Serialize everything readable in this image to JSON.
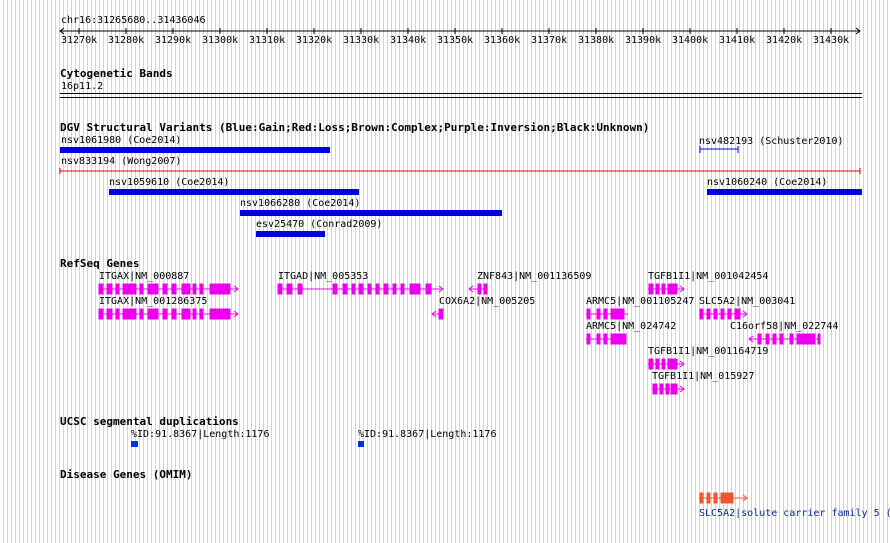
{
  "ruler": {
    "position": "chr16:31265680..31436046",
    "ticks": [
      "31270k",
      "31280k",
      "31290k",
      "31300k",
      "31310k",
      "31320k",
      "31330k",
      "31340k",
      "31350k",
      "31360k",
      "31370k",
      "31380k",
      "31390k",
      "31400k",
      "31410k",
      "31420k",
      "31430k"
    ]
  },
  "cytobands": {
    "title": "Cytogenetic Bands",
    "band": "16p11.2"
  },
  "dgv": {
    "title": "DGV Structural Variants (Blue:Gain;Red:Loss;Brown:Complex;Purple:Inversion;Black:Unknown)",
    "variants": [
      {
        "label": "nsv1061980 (Coe2014)",
        "type": "Gain"
      },
      {
        "label": "nsv482193 (Schuster2010)",
        "type": "Gain"
      },
      {
        "label": "nsv833194 (Wong2007)",
        "type": "Loss"
      },
      {
        "label": "nsv1059610 (Coe2014)",
        "type": "Gain"
      },
      {
        "label": "nsv1060240 (Coe2014)",
        "type": "Gain"
      },
      {
        "label": "nsv1066280 (Coe2014)",
        "type": "Gain"
      },
      {
        "label": "esv25470 (Conrad2009)",
        "type": "Gain"
      }
    ]
  },
  "refseq": {
    "title": "RefSeq Genes",
    "genes": [
      {
        "label": "ITGAX|NM_000887",
        "strand": "+"
      },
      {
        "label": "ITGAX|NM_001286375",
        "strand": "+"
      },
      {
        "label": "ITGAD|NM_005353",
        "strand": "+"
      },
      {
        "label": "ZNF843|NM_001136509",
        "strand": "-"
      },
      {
        "label": "COX6A2|NM_005205",
        "strand": "-"
      },
      {
        "label": "TGFB1I1|NM_001042454",
        "strand": "+"
      },
      {
        "label": "ARMC5|NM_001105247",
        "strand": "+"
      },
      {
        "label": "SLC5A2|NM_003041",
        "strand": "+"
      },
      {
        "label": "ARMC5|NM_024742",
        "strand": "+"
      },
      {
        "label": "C16orf58|NM_022744",
        "strand": "-"
      },
      {
        "label": "TGFB1I1|NM_001164719",
        "strand": "+"
      },
      {
        "label": "TGFB1I1|NM_015927",
        "strand": "+"
      }
    ]
  },
  "segdups": {
    "title": "UCSC segmental duplications",
    "items": [
      {
        "label": "%ID:91.8367|Length:1176"
      },
      {
        "label": "%ID:91.8367|Length:1176"
      }
    ]
  },
  "omim": {
    "title": "Disease Genes (OMIM)",
    "items": [
      {
        "label": "SLC5A2|solute carrier family 5 ("
      }
    ]
  },
  "colors": {
    "gain": "#0000dd",
    "loss": "#dd0000",
    "gene": "#ee00ee",
    "segdup": "#0033dd",
    "omim": "#ee5533",
    "grid": "#b9dde3"
  }
}
